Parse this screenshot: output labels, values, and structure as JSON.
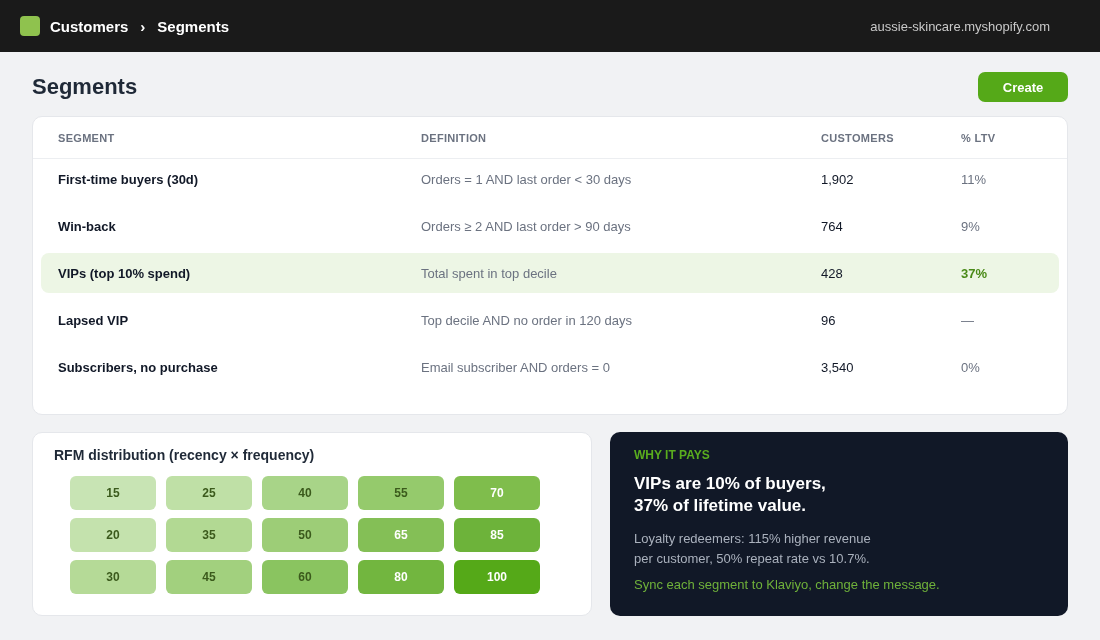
{
  "topbar": {
    "breadcrumb": [
      {
        "label": "Customers"
      },
      {
        "label": "Segments"
      }
    ],
    "separator": "›",
    "store": "aussie-skincare.myshopify.com"
  },
  "page": {
    "title": "Segments",
    "primary_action": "Create"
  },
  "segments_table": {
    "columns": [
      "SEGMENT",
      "DEFINITION",
      "CUSTOMERS",
      "% LTV"
    ],
    "rows": [
      {
        "name": "First-time buyers (30d)",
        "definition": "Orders = 1 AND last order < 30 days",
        "customers": "1,902",
        "ltv": "11%",
        "highlighted": false
      },
      {
        "name": "Win-back",
        "definition": "Orders ≥ 2 AND last order > 90 days",
        "customers": "764",
        "ltv": "9%",
        "highlighted": false
      },
      {
        "name": "VIPs (top 10% spend)",
        "definition": "Total spent in top decile",
        "customers": "428",
        "ltv": "37%",
        "highlighted": true
      },
      {
        "name": "Lapsed VIP",
        "definition": "Top decile AND no order in 120 days",
        "customers": "96",
        "ltv": "—",
        "highlighted": false
      },
      {
        "name": "Subscribers, no purchase",
        "definition": "Email subscriber AND orders = 0",
        "customers": "3,540",
        "ltv": "0%",
        "highlighted": false
      }
    ]
  },
  "rfm": {
    "title": "RFM distribution (recency × frequency)",
    "rows": [
      {
        "cells": [
          {
            "value": "15",
            "color": "#c8e4b4"
          },
          {
            "value": "25",
            "color": "#bfe0a6"
          },
          {
            "value": "40",
            "color": "#a8d488"
          },
          {
            "value": "55",
            "color": "#95ca6c"
          },
          {
            "value": "70",
            "color": "#7fbd4c"
          }
        ]
      },
      {
        "cells": [
          {
            "value": "20",
            "color": "#c4e2ad"
          },
          {
            "value": "35",
            "color": "#b2d993"
          },
          {
            "value": "50",
            "color": "#9dcd77"
          },
          {
            "value": "65",
            "color": "#84bf56"
          },
          {
            "value": "85",
            "color": "#6db33a"
          }
        ]
      },
      {
        "cells": [
          {
            "value": "30",
            "color": "#b5da97"
          },
          {
            "value": "45",
            "color": "#a2d07e"
          },
          {
            "value": "60",
            "color": "#8ac460"
          },
          {
            "value": "80",
            "color": "#72b63f"
          },
          {
            "value": "100",
            "color": "#55a918"
          }
        ]
      }
    ]
  },
  "insight": {
    "eyebrow": "WHY IT PAYS",
    "headline": [
      "VIPs are 10% of buyers,",
      "37% of lifetime value."
    ],
    "body": [
      "Loyalty redeemers: 115% higher revenue",
      "per customer, 50% repeat rate vs 10.7%."
    ],
    "cta": "Sync each segment to Klaviyo, change the message."
  }
}
